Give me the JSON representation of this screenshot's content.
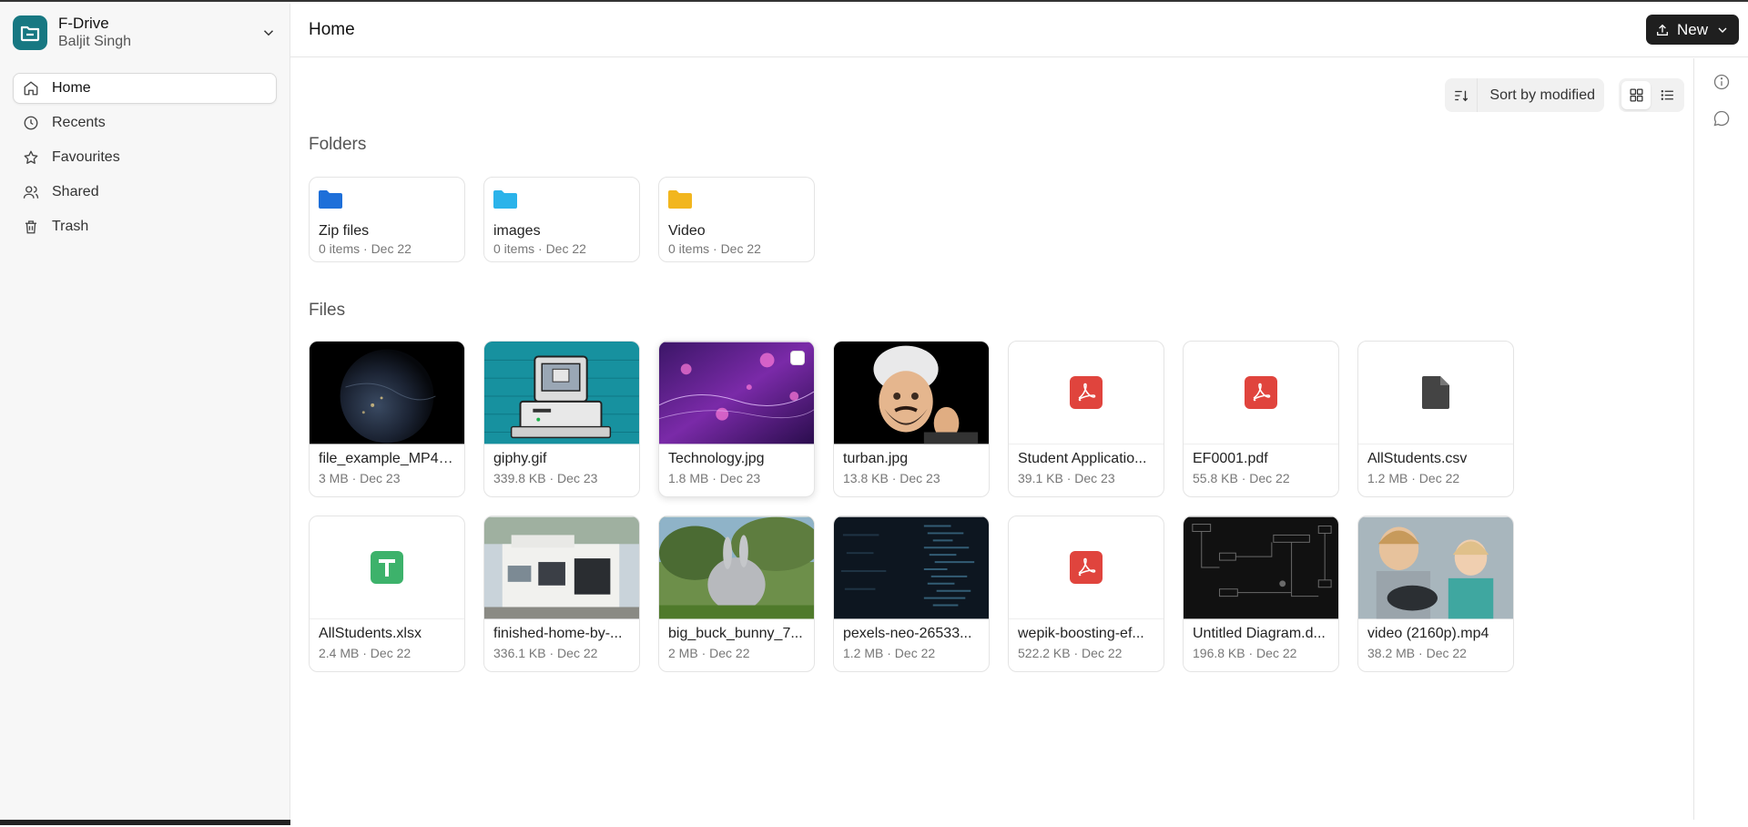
{
  "account": {
    "app_name": "F-Drive",
    "user_name": "Baljit Singh"
  },
  "nav": [
    {
      "label": "Home",
      "icon": "home-icon"
    },
    {
      "label": "Recents",
      "icon": "clock-icon"
    },
    {
      "label": "Favourites",
      "icon": "star-icon"
    },
    {
      "label": "Shared",
      "icon": "users-icon"
    },
    {
      "label": "Trash",
      "icon": "trash-icon"
    }
  ],
  "header": {
    "title": "Home",
    "new_label": "New"
  },
  "toolbar": {
    "sort_label": "Sort by modified"
  },
  "sections": {
    "folders": "Folders",
    "files": "Files"
  },
  "folders": [
    {
      "name": "Zip files",
      "meta": "0 items · Dec 22",
      "color": "#1e6fd9"
    },
    {
      "name": "images",
      "meta": "0 items · Dec 22",
      "color": "#2bb3ea"
    },
    {
      "name": "Video",
      "meta": "0 items · Dec 22",
      "color": "#f2b61e"
    }
  ],
  "files": [
    {
      "name": "file_example_MP4_...",
      "meta": "3 MB · Dec 23",
      "kind": "earth"
    },
    {
      "name": "giphy.gif",
      "meta": "339.8 KB · Dec 23",
      "kind": "computer"
    },
    {
      "name": "Technology.jpg",
      "meta": "1.8 MB · Dec 23",
      "kind": "tech"
    },
    {
      "name": "turban.jpg",
      "meta": "13.8 KB · Dec 23",
      "kind": "turban"
    },
    {
      "name": "Student Applicatio...",
      "meta": "39.1 KB · Dec 23",
      "kind": "pdf"
    },
    {
      "name": "EF0001.pdf",
      "meta": "55.8 KB · Dec 22",
      "kind": "pdf"
    },
    {
      "name": "AllStudents.csv",
      "meta": "1.2 MB · Dec 22",
      "kind": "doc"
    },
    {
      "name": "AllStudents.xlsx",
      "meta": "2.4 MB · Dec 22",
      "kind": "sheet"
    },
    {
      "name": "finished-home-by-...",
      "meta": "336.1 KB · Dec 22",
      "kind": "house"
    },
    {
      "name": "big_buck_bunny_7...",
      "meta": "2 MB · Dec 22",
      "kind": "bunny"
    },
    {
      "name": "pexels-neo-26533...",
      "meta": "1.2 MB · Dec 22",
      "kind": "code"
    },
    {
      "name": "wepik-boosting-ef...",
      "meta": "522.2 KB · Dec 22",
      "kind": "pdf"
    },
    {
      "name": "Untitled Diagram.d...",
      "meta": "196.8 KB · Dec 22",
      "kind": "diagram"
    },
    {
      "name": "video (2160p).mp4",
      "meta": "38.2 MB · Dec 22",
      "kind": "kids"
    }
  ],
  "colors": {
    "brand": "#177882",
    "pdf": "#e0443d",
    "sheet": "#3db26b",
    "doc": "#444444",
    "new_button": "#1f1f1f"
  }
}
